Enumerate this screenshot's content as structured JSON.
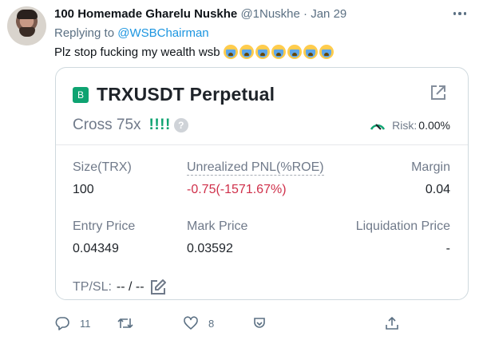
{
  "tweet": {
    "author_name": "100 Homemade Gharelu Nuskhe",
    "handle": "@1Nuskhe",
    "separator": "·",
    "date": "Jan 29",
    "replying_prefix": "Replying to",
    "replying_handle": "@WSBChairman",
    "text": "Plz stop fucking my wealth wsb",
    "emoji_name": "loudly-crying-face",
    "emoji_count": 7
  },
  "card": {
    "logo_letter": "B",
    "title": "TRXUSDT Perpetual",
    "mode": "Cross 75x",
    "warning": "!!!!",
    "help": "?",
    "risk_label": "Risk:",
    "risk_value": "0.00%",
    "fields": {
      "size_label": "Size(TRX)",
      "size_value": "100",
      "pnl_label": "Unrealized PNL(%ROE)",
      "pnl_value": "-0.75(-1571.67%)",
      "margin_label": "Margin",
      "margin_value": "0.04",
      "entry_label": "Entry Price",
      "entry_value": "0.04349",
      "mark_label": "Mark Price",
      "mark_value": "0.03592",
      "liq_label": "Liquidation Price",
      "liq_value": "-"
    },
    "tpsl_label": "TP/SL:",
    "tpsl_value": "-- / --"
  },
  "actions": {
    "reply_count": "11",
    "retweet_count": "",
    "like_count": "8"
  },
  "colors": {
    "link": "#1b95e0",
    "positive": "#0ea371",
    "negative": "#cf304a",
    "muted": "#707a8a"
  },
  "icons": [
    "more-icon",
    "expand-icon",
    "risk-gauge-icon",
    "edit-icon",
    "reply-icon",
    "retweet-icon",
    "like-icon",
    "tip-icon",
    "share-icon"
  ]
}
